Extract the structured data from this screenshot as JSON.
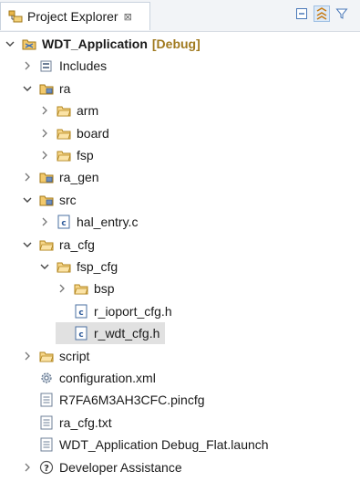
{
  "view": {
    "tab_label": "Project Explorer",
    "tab_close": "⊠"
  },
  "toolbar": {
    "buttons": [
      "collapse-all",
      "link-with-editor",
      "filter",
      "view-menu",
      "minimize"
    ]
  },
  "tree": [
    {
      "label": "WDT_Application",
      "decoration": "[Debug]",
      "icon": "project-icon",
      "twisty": "expanded",
      "level": 0,
      "bold": true
    },
    {
      "label": "Includes",
      "icon": "includes-icon",
      "twisty": "collapsed",
      "level": 1
    },
    {
      "label": "ra",
      "icon": "source-folder-icon",
      "twisty": "expanded",
      "level": 1
    },
    {
      "label": "arm",
      "icon": "folder-icon",
      "twisty": "collapsed",
      "level": 2
    },
    {
      "label": "board",
      "icon": "folder-icon",
      "twisty": "collapsed",
      "level": 2
    },
    {
      "label": "fsp",
      "icon": "folder-icon",
      "twisty": "collapsed",
      "level": 2
    },
    {
      "label": "ra_gen",
      "icon": "source-folder-icon",
      "twisty": "collapsed",
      "level": 1
    },
    {
      "label": "src",
      "icon": "source-folder-icon",
      "twisty": "expanded",
      "level": 1
    },
    {
      "label": "hal_entry.c",
      "icon": "c-file-icon",
      "twisty": "collapsed",
      "level": 2
    },
    {
      "label": "ra_cfg",
      "icon": "folder-icon",
      "twisty": "expanded",
      "level": 1
    },
    {
      "label": "fsp_cfg",
      "icon": "folder-icon",
      "twisty": "expanded",
      "level": 2
    },
    {
      "label": "bsp",
      "icon": "folder-icon",
      "twisty": "collapsed",
      "level": 3
    },
    {
      "label": "r_ioport_cfg.h",
      "icon": "h-file-icon",
      "twisty": "none",
      "level": 3
    },
    {
      "label": "r_wdt_cfg.h",
      "icon": "h-file-icon",
      "twisty": "none",
      "level": 3,
      "selected": true
    },
    {
      "label": "script",
      "icon": "folder-icon",
      "twisty": "collapsed",
      "level": 1
    },
    {
      "label": "configuration.xml",
      "icon": "gear-icon",
      "twisty": "none",
      "level": 1
    },
    {
      "label": "R7FA6M3AH3CFC.pincfg",
      "icon": "text-file-icon",
      "twisty": "none",
      "level": 1
    },
    {
      "label": "ra_cfg.txt",
      "icon": "text-file-icon",
      "twisty": "none",
      "level": 1
    },
    {
      "label": "WDT_Application Debug_Flat.launch",
      "icon": "text-file-icon",
      "twisty": "none",
      "level": 1
    },
    {
      "label": "Developer Assistance",
      "icon": "help-icon",
      "twisty": "collapsed",
      "level": 1
    }
  ]
}
